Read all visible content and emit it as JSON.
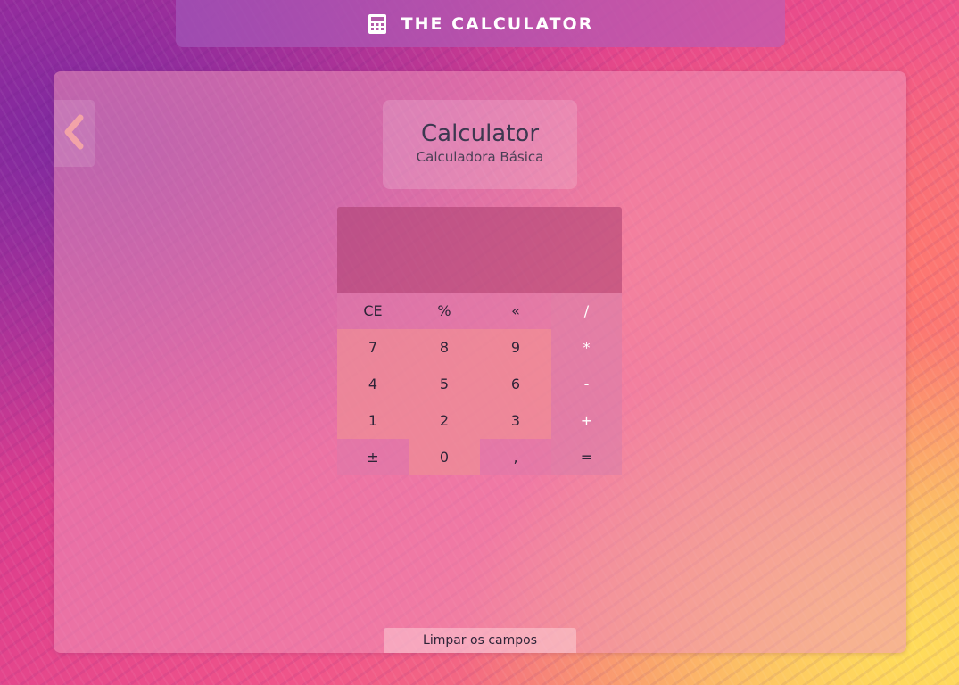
{
  "header": {
    "icon": "calculator-icon",
    "title": "THE CALCULATOR"
  },
  "nav": {
    "back_icon": "chevron-left-icon"
  },
  "card": {
    "title": "Calculator",
    "subtitle": "Calculadora Básica"
  },
  "calculator": {
    "display_value": "",
    "keys": [
      {
        "label": "CE",
        "kind": "fn",
        "name": "key-clear-entry"
      },
      {
        "label": "%",
        "kind": "fn",
        "name": "key-percent"
      },
      {
        "label": "«",
        "kind": "fn",
        "name": "key-backspace"
      },
      {
        "label": "/",
        "kind": "op",
        "name": "key-divide"
      },
      {
        "label": "7",
        "kind": "num",
        "name": "key-7"
      },
      {
        "label": "8",
        "kind": "num",
        "name": "key-8"
      },
      {
        "label": "9",
        "kind": "num",
        "name": "key-9"
      },
      {
        "label": "*",
        "kind": "op",
        "name": "key-multiply"
      },
      {
        "label": "4",
        "kind": "num",
        "name": "key-4"
      },
      {
        "label": "5",
        "kind": "num",
        "name": "key-5"
      },
      {
        "label": "6",
        "kind": "num",
        "name": "key-6"
      },
      {
        "label": "-",
        "kind": "op",
        "name": "key-subtract"
      },
      {
        "label": "1",
        "kind": "num",
        "name": "key-1"
      },
      {
        "label": "2",
        "kind": "num",
        "name": "key-2"
      },
      {
        "label": "3",
        "kind": "num",
        "name": "key-3"
      },
      {
        "label": "+",
        "kind": "op",
        "name": "key-add"
      },
      {
        "label": "±",
        "kind": "fn",
        "name": "key-negate"
      },
      {
        "label": "0",
        "kind": "num",
        "name": "key-0"
      },
      {
        "label": ",",
        "kind": "fn",
        "name": "key-decimal"
      },
      {
        "label": "=",
        "kind": "op-eq",
        "name": "key-equals"
      }
    ]
  },
  "footer": {
    "clear_label": "Limpar os campos"
  },
  "colors": {
    "title_text": "#3d3850",
    "header_text": "#ffffff"
  }
}
